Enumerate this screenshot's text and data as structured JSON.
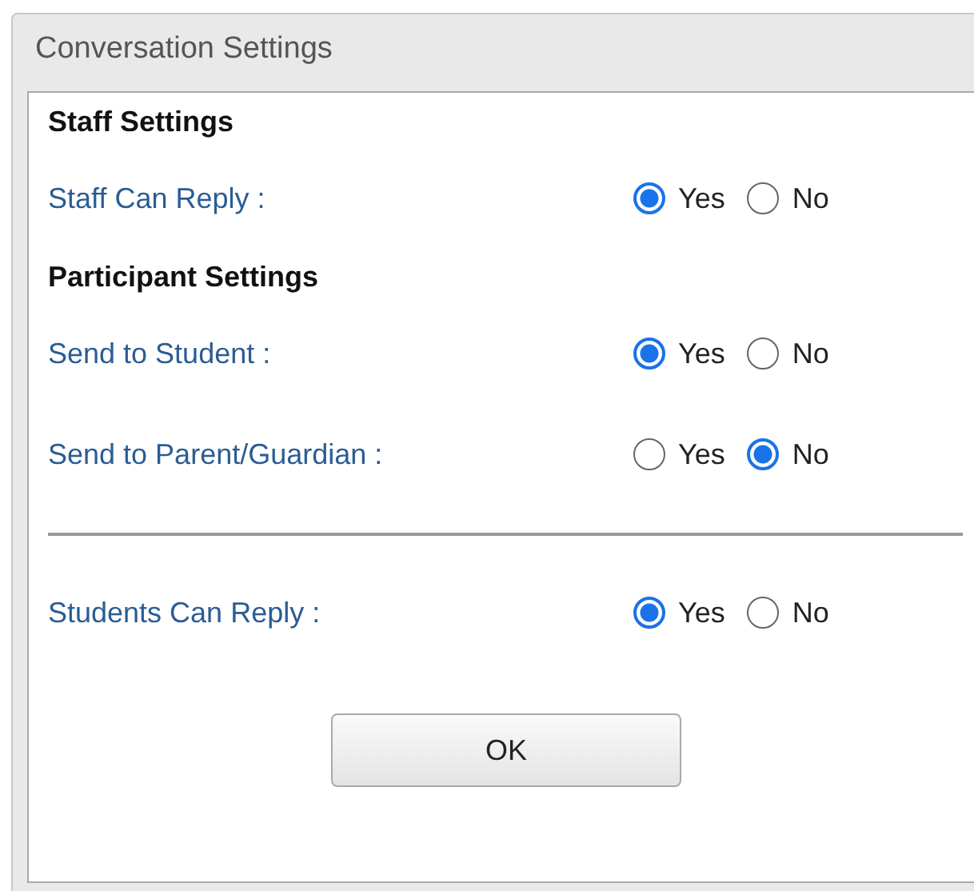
{
  "window": {
    "title": "Conversation Settings"
  },
  "items": [
    {
      "kind": "heading",
      "text": "Staff Settings"
    },
    {
      "kind": "setting",
      "label": "Staff Can Reply :",
      "options": [
        {
          "label": "Yes",
          "selected": true
        },
        {
          "label": "No",
          "selected": false
        }
      ]
    },
    {
      "kind": "heading",
      "text": "Participant Settings"
    },
    {
      "kind": "setting",
      "label": "Send to Student :",
      "options": [
        {
          "label": "Yes",
          "selected": true
        },
        {
          "label": "No",
          "selected": false
        }
      ]
    },
    {
      "kind": "setting",
      "label": "Send to Parent/Guardian :",
      "options": [
        {
          "label": "Yes",
          "selected": false
        },
        {
          "label": "No",
          "selected": true
        }
      ]
    },
    {
      "kind": "divider"
    },
    {
      "kind": "setting",
      "label": "Students Can Reply :",
      "options": [
        {
          "label": "Yes",
          "selected": true
        },
        {
          "label": "No",
          "selected": false
        }
      ]
    }
  ],
  "buttons": [
    "OK"
  ]
}
